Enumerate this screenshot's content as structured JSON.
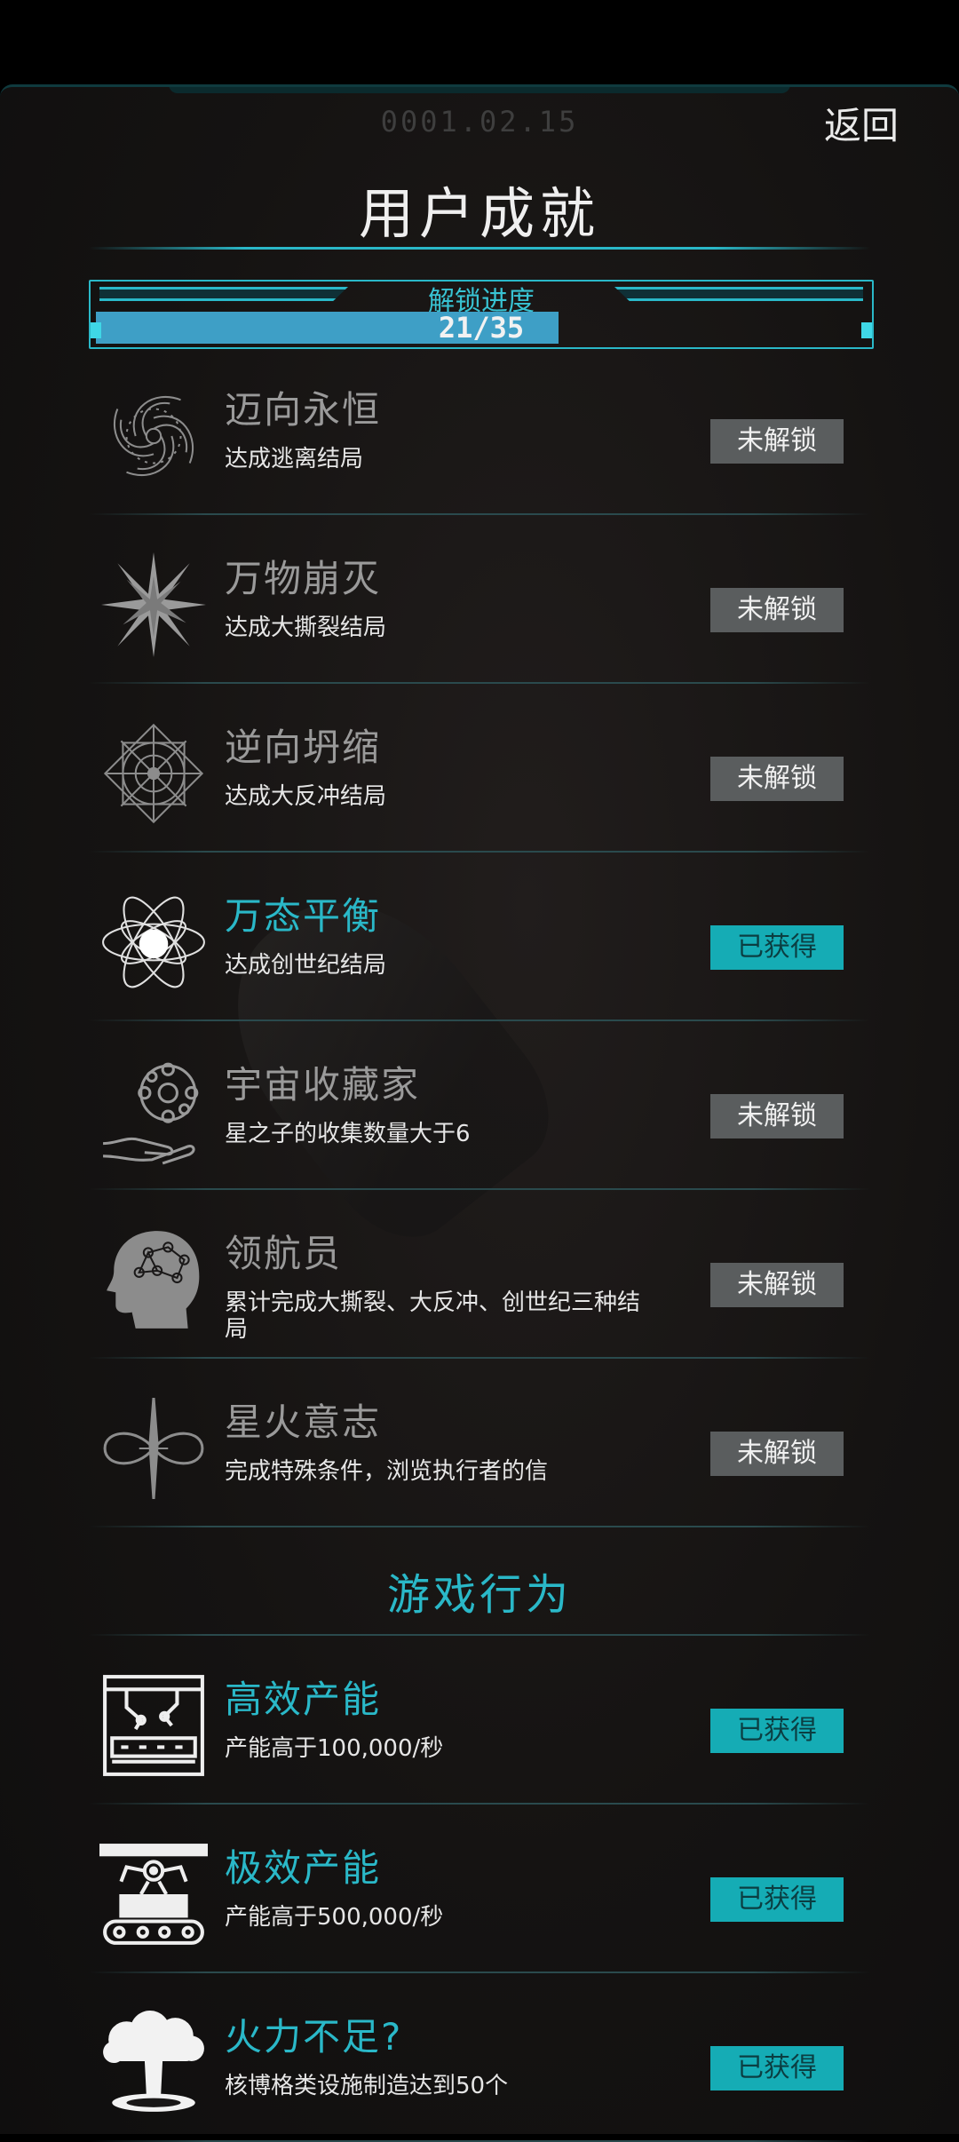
{
  "header": {
    "date": "0001.02.15",
    "back_label": "返回",
    "title": "用户成就"
  },
  "progress": {
    "label": "解锁进度",
    "text": "21/35",
    "unlocked": 21,
    "total": 35
  },
  "achievements": [
    {
      "name": "迈向永恒",
      "desc": "达成逃离结局",
      "status": "未解锁",
      "icon": "spiral-galaxy-icon"
    },
    {
      "name": "万物崩灭",
      "desc": "达成大撕裂结局",
      "status": "未解锁",
      "icon": "starburst-icon"
    },
    {
      "name": "逆向坍缩",
      "desc": "达成大反冲结局",
      "status": "未解锁",
      "icon": "mandala-icon"
    },
    {
      "name": "万态平衡",
      "desc": "达成创世纪结局",
      "status": "已获得",
      "icon": "atom-orbit-icon"
    },
    {
      "name": "宇宙收藏家",
      "desc": "星之子的收集数量大于6",
      "status": "未解锁",
      "icon": "hand-globe-icon"
    },
    {
      "name": "领航员",
      "desc": "累计完成大撕裂、大反冲、创世纪三种结局",
      "status": "未解锁",
      "icon": "brain-head-icon"
    },
    {
      "name": "星火意志",
      "desc": "完成特殊条件，浏览执行者的信",
      "status": "未解锁",
      "icon": "infinity-star-icon"
    }
  ],
  "section": {
    "title": "游戏行为"
  },
  "behaviors": [
    {
      "name": "高效产能",
      "desc": "产能高于100,000/秒",
      "status": "已获得",
      "icon": "factory-arm-icon"
    },
    {
      "name": "极效产能",
      "desc": "产能高于500,000/秒",
      "status": "已获得",
      "icon": "conveyor-robot-icon"
    },
    {
      "name": "火力不足?",
      "desc": "核博格类设施制造达到50个",
      "status": "已获得",
      "icon": "mushroom-cloud-icon"
    }
  ],
  "colors": {
    "accent": "#2ab8c8",
    "locked_badge": "#5a5d5e",
    "earned_badge": "#15acb5",
    "background": "#151312"
  }
}
